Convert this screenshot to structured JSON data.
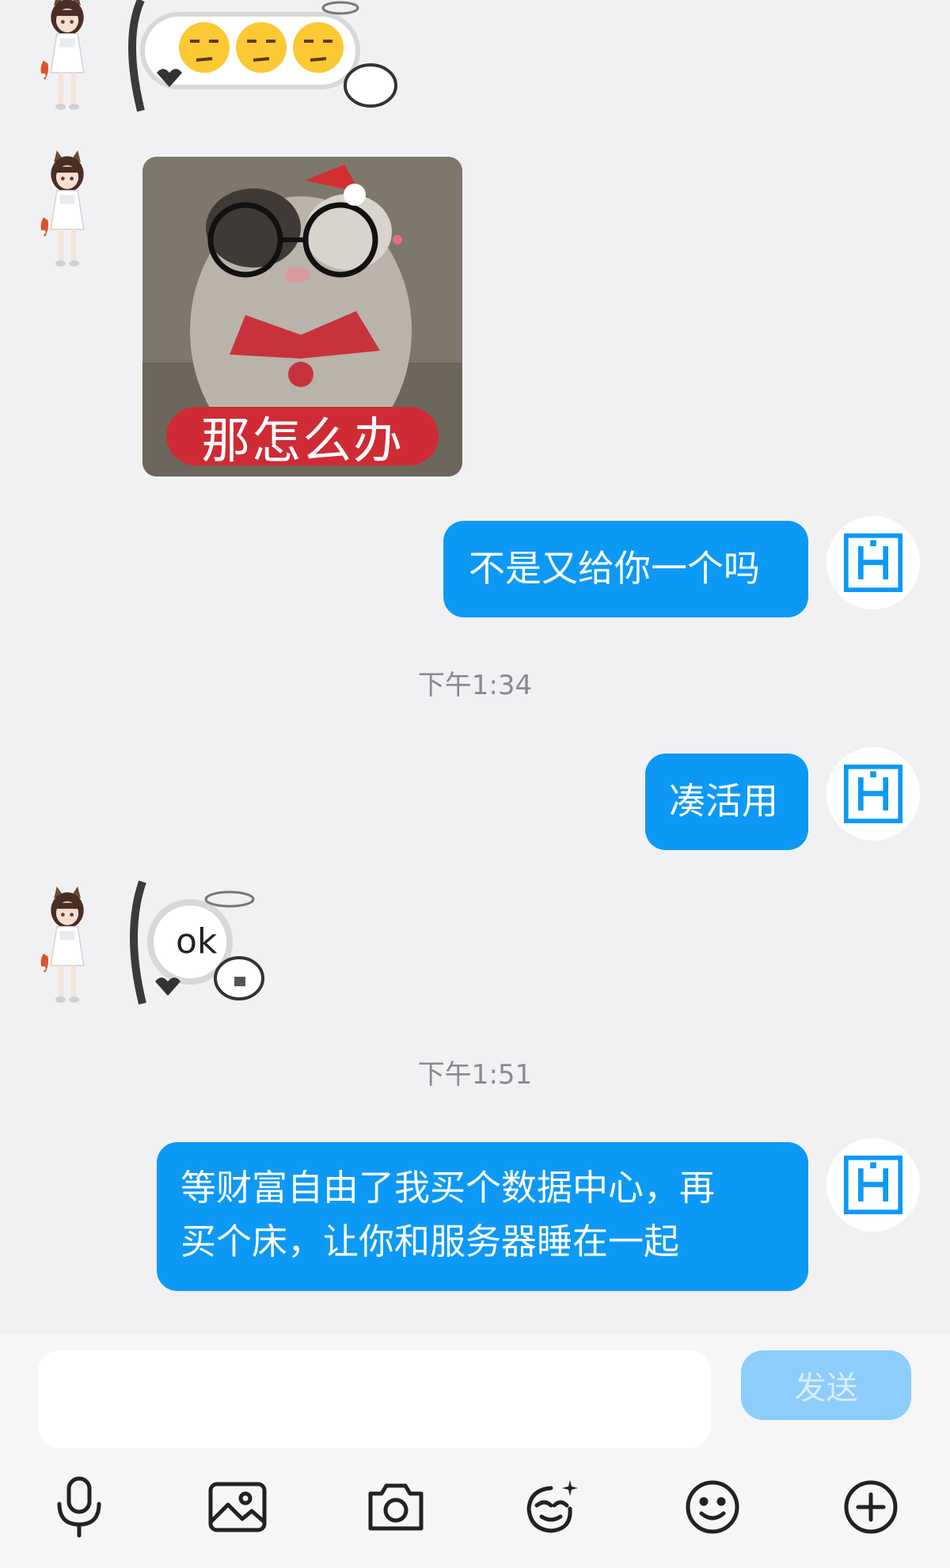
{
  "messages": [
    {
      "id": "m1",
      "direction": "in",
      "type": "sticker",
      "sticker_name": "three-unamused-faces-sticker"
    },
    {
      "id": "m2",
      "direction": "in",
      "type": "sticker",
      "sticker_name": "cat-glasses-sticker",
      "caption": "那怎么办"
    },
    {
      "id": "m3",
      "direction": "out",
      "type": "text",
      "text": "不是又给你一个吗"
    },
    {
      "id": "t1",
      "type": "timestamp",
      "text": "下午1:34"
    },
    {
      "id": "m4",
      "direction": "out",
      "type": "text",
      "text": "凑活用"
    },
    {
      "id": "m5",
      "direction": "in",
      "type": "sticker",
      "sticker_name": "ok-sticker",
      "text": "ok"
    },
    {
      "id": "t2",
      "type": "timestamp",
      "text": "下午1:51"
    },
    {
      "id": "m6",
      "direction": "out",
      "type": "text",
      "line1": "等财富自由了我买个数据中心，再",
      "line2": "买个床，让你和服务器睡在一起"
    }
  ],
  "my_avatar": {
    "letter": "H",
    "accent": "#0c99f6"
  },
  "composer": {
    "value": "",
    "send_label": "发送"
  },
  "toolbar": [
    "microphone-icon",
    "image-icon",
    "camera-icon",
    "sticker-icon",
    "emoji-icon",
    "plus-icon"
  ],
  "colors": {
    "bubble_out": "#0c99f6",
    "background": "#f1f1f3",
    "send_disabled": "#8ccdfb"
  }
}
